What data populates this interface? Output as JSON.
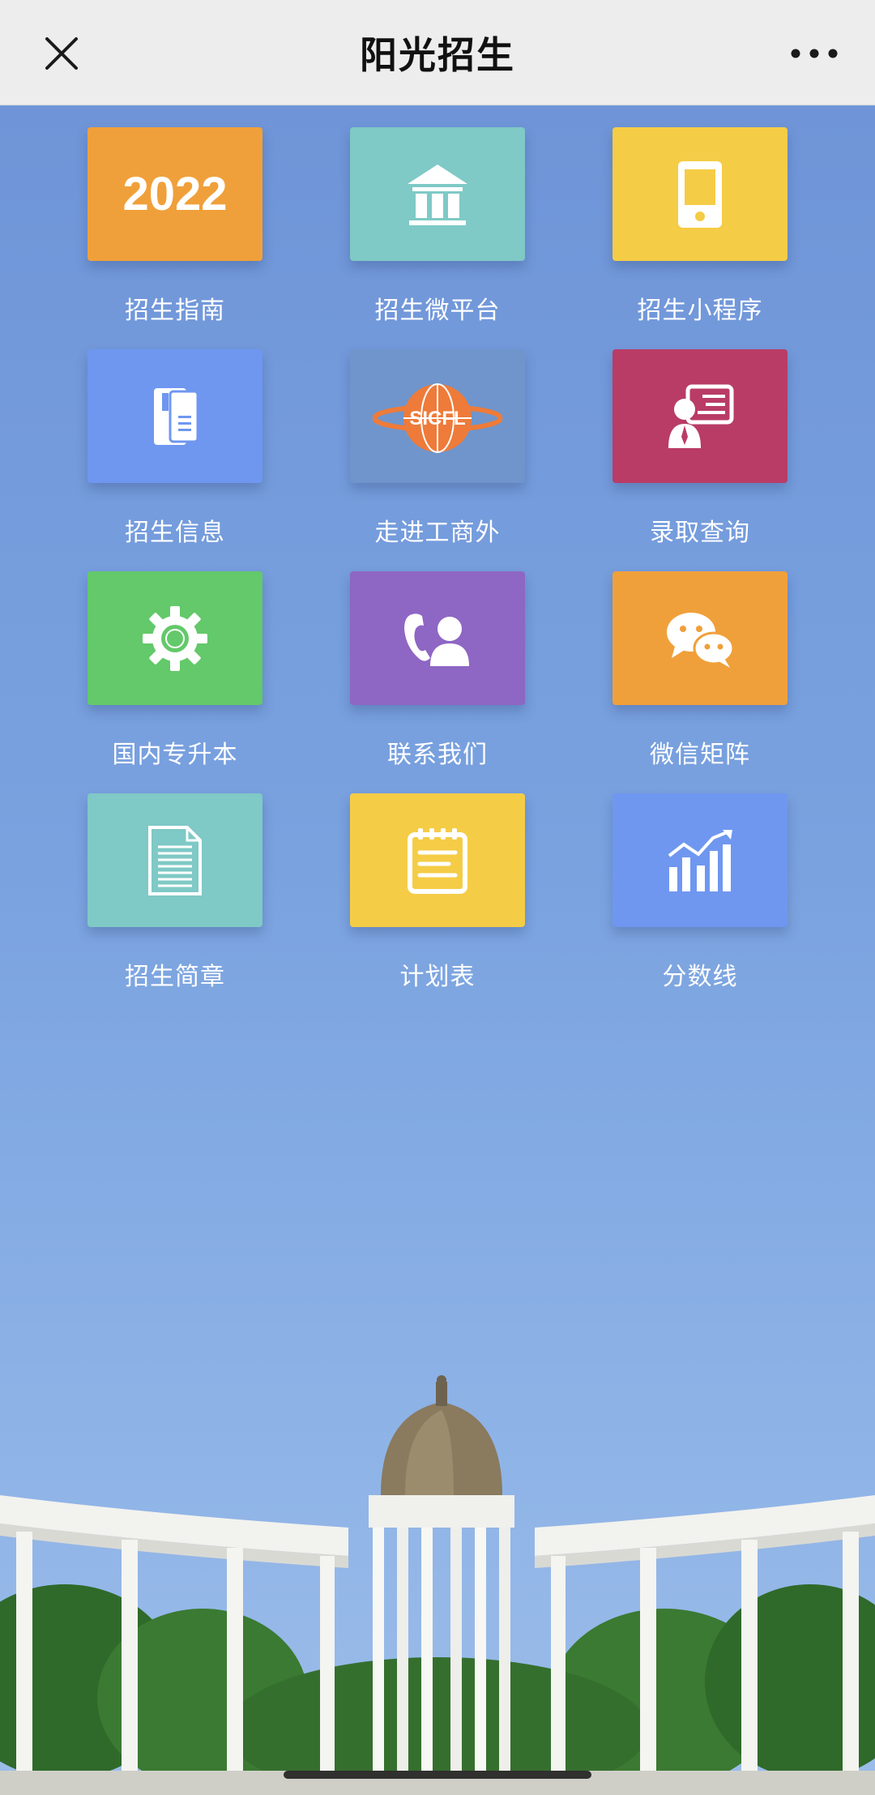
{
  "header": {
    "title": "阳光招生",
    "close_icon": "close-icon",
    "more_icon": "more-icon"
  },
  "colors": {
    "orange": "#f0a03a",
    "teal": "#7fc9c6",
    "yellow": "#f5cc46",
    "blue": "#6f97f0",
    "crimson": "#b93c66",
    "green": "#63c96a",
    "purple": "#8e66c4",
    "logo_bg": "#6f95cc"
  },
  "tiles": [
    {
      "label": "招生指南",
      "icon": "year-badge",
      "badge_text": "2022"
    },
    {
      "label": "招生微平台",
      "icon": "bank-icon"
    },
    {
      "label": "招生小程序",
      "icon": "phone-icon"
    },
    {
      "label": "招生信息",
      "icon": "files-icon"
    },
    {
      "label": "走进工商外",
      "icon": "school-logo",
      "logo_text": "SICFL"
    },
    {
      "label": "录取查询",
      "icon": "presenter-icon"
    },
    {
      "label": "国内专升本",
      "icon": "gear-icon"
    },
    {
      "label": "联系我们",
      "icon": "contact-phone-icon"
    },
    {
      "label": "微信矩阵",
      "icon": "wechat-icon"
    },
    {
      "label": "招生简章",
      "icon": "document-icon"
    },
    {
      "label": "计划表",
      "icon": "notepad-icon"
    },
    {
      "label": "分数线",
      "icon": "chart-icon"
    }
  ]
}
